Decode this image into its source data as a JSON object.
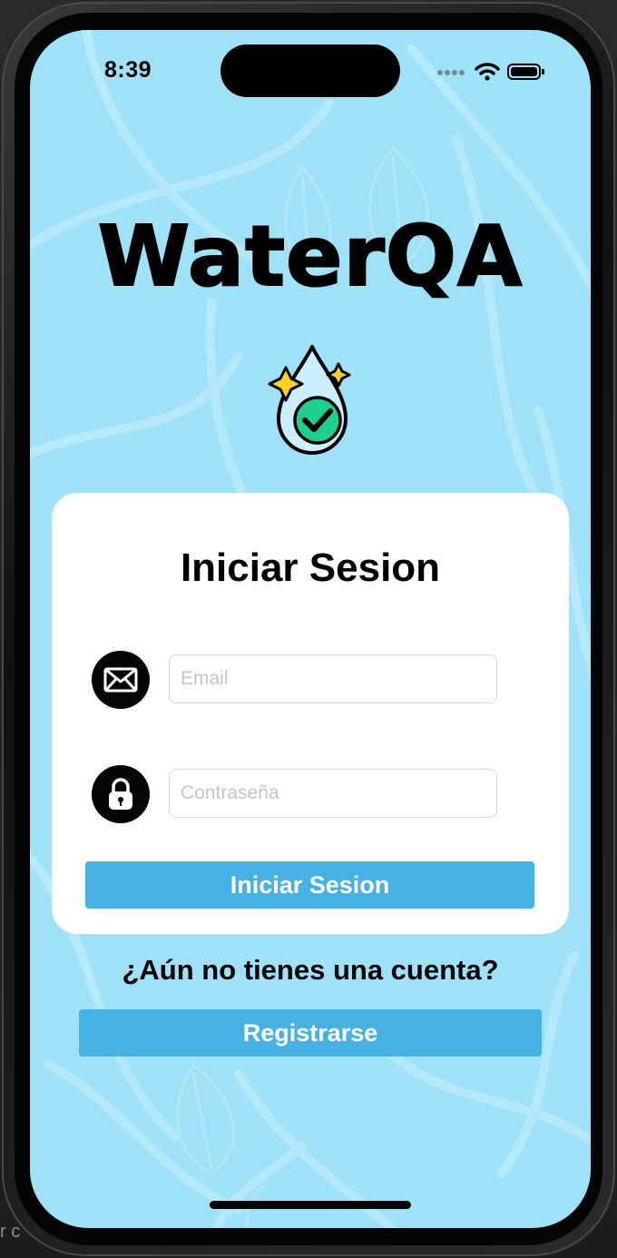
{
  "status_bar": {
    "time": "8:39",
    "icons": [
      "signal-icon",
      "wifi-icon",
      "battery-icon"
    ]
  },
  "app": {
    "title": "WaterQA",
    "logo_icon": "water-drop-check-icon"
  },
  "login_card": {
    "title": "Iniciar Sesion",
    "email": {
      "icon": "envelope-icon",
      "placeholder": "Email",
      "value": ""
    },
    "password": {
      "icon": "lock-icon",
      "placeholder": "Contraseña",
      "value": ""
    },
    "submit_label": "Iniciar Sesion"
  },
  "register": {
    "prompt": "¿Aún no tienes una cuenta?",
    "button_label": "Registrarse"
  },
  "background_hint": "r c",
  "colors": {
    "screen_background": "#9fe2f7",
    "button": "#46b1e3",
    "card": "#ffffff",
    "icon_circle": "#050505"
  }
}
